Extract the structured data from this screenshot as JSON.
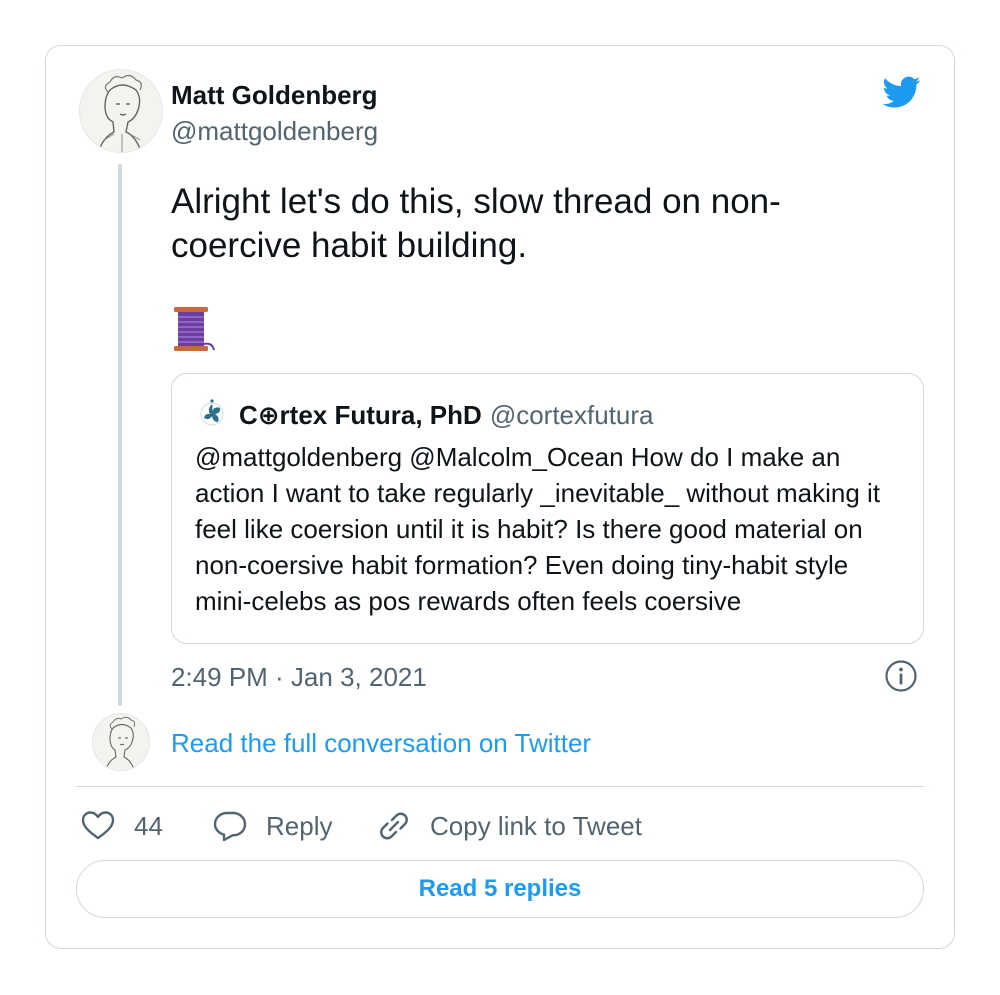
{
  "author": {
    "name": "Matt Goldenberg",
    "handle": "@mattgoldenberg"
  },
  "tweet": {
    "text": "Alright let's do this, slow thread on non-coercive habit building.",
    "emoji": "spool-of-thread",
    "timestamp": "2:49 PM · Jan 3, 2021"
  },
  "quoted_tweet": {
    "name": "C⊕rtex Futura, PhD",
    "handle": "@cortexfutura",
    "text": "@mattgoldenberg @Malcolm_Ocean How do I make an action I want to take regularly _inevitable_ without making it feel like coersion until it is habit? Is there good material on non-coersive habit formation? Even doing tiny-habit style mini-celebs as pos rewards often feels coersive"
  },
  "conversation_link": "Read the full conversation on Twitter",
  "actions": {
    "like_count": "44",
    "reply_label": "Reply",
    "copy_label": "Copy link to Tweet"
  },
  "replies_button": "Read 5 replies",
  "colors": {
    "accent": "#1d9bf0",
    "secondary_text": "#536471",
    "border": "#cfd9de"
  },
  "icons": [
    "twitter-bird-icon",
    "info-icon",
    "heart-icon",
    "reply-icon",
    "link-icon",
    "spool-emoji"
  ]
}
